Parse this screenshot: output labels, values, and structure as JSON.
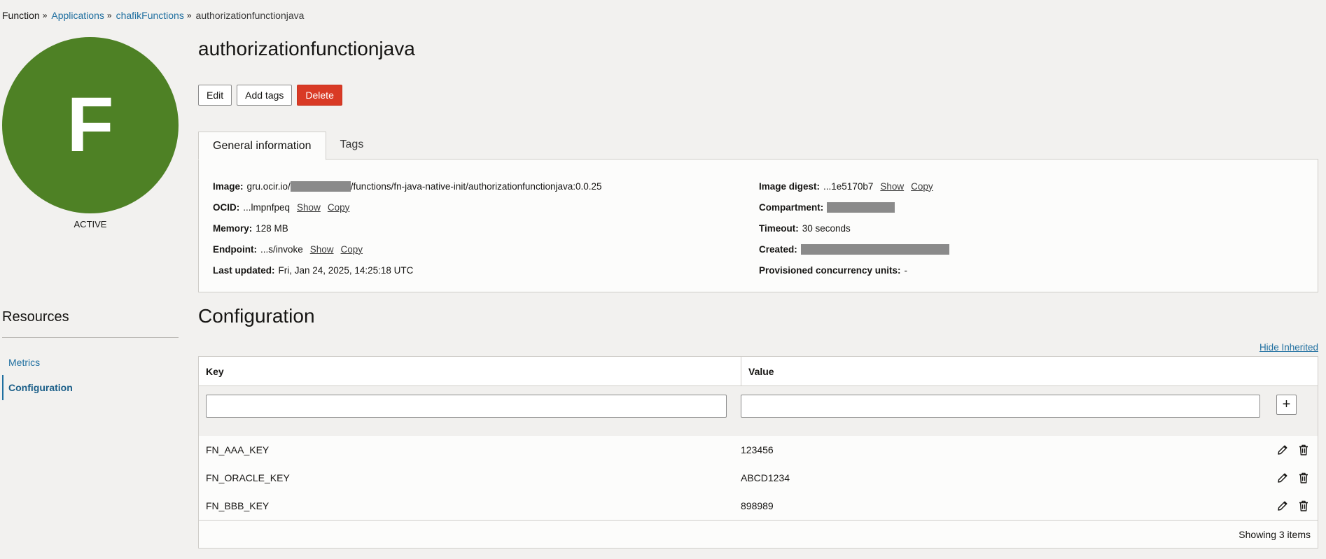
{
  "breadcrumb": {
    "root": "Function",
    "applications": "Applications",
    "app": "chafikFunctions",
    "current": "authorizationfunctionjava",
    "separator": "»"
  },
  "avatar": {
    "letter": "F",
    "status": "ACTIVE",
    "color": "#4e8125"
  },
  "page_title": "authorizationfunctionjava",
  "actions": {
    "edit": "Edit",
    "add_tags": "Add tags",
    "delete": "Delete"
  },
  "tabs": {
    "general": "General information",
    "tags": "Tags"
  },
  "info": {
    "image": {
      "label": "Image:",
      "prefix": "gru.ocir.io/",
      "suffix": "/functions/fn-java-native-init/authorizationfunctionjava:0.0.25"
    },
    "ocid": {
      "label": "OCID:",
      "value": "...lmpnfpeq",
      "show": "Show",
      "copy": "Copy"
    },
    "memory": {
      "label": "Memory:",
      "value": "128 MB"
    },
    "endpoint": {
      "label": "Endpoint:",
      "value": "...s/invoke",
      "show": "Show",
      "copy": "Copy"
    },
    "last_updated": {
      "label": "Last updated:",
      "value": "Fri, Jan 24, 2025, 14:25:18 UTC"
    },
    "image_digest": {
      "label": "Image digest:",
      "value": "...1e5170b7",
      "show": "Show",
      "copy": "Copy"
    },
    "compartment": {
      "label": "Compartment:"
    },
    "timeout": {
      "label": "Timeout:",
      "value": "30 seconds"
    },
    "created": {
      "label": "Created:"
    },
    "provisioned": {
      "label": "Provisioned concurrency units:",
      "value": "-"
    }
  },
  "resources": {
    "title": "Resources",
    "items": [
      {
        "label": "Metrics"
      },
      {
        "label": "Configuration"
      }
    ]
  },
  "configuration": {
    "title": "Configuration",
    "hide_inherited": "Hide Inherited",
    "columns": {
      "key": "Key",
      "value": "Value"
    },
    "add_symbol": "+",
    "rows": [
      {
        "key": "FN_AAA_KEY",
        "value": "123456"
      },
      {
        "key": "FN_ORACLE_KEY",
        "value": "ABCD1234"
      },
      {
        "key": "FN_BBB_KEY",
        "value": "898989"
      }
    ],
    "footer": "Showing 3 items"
  }
}
